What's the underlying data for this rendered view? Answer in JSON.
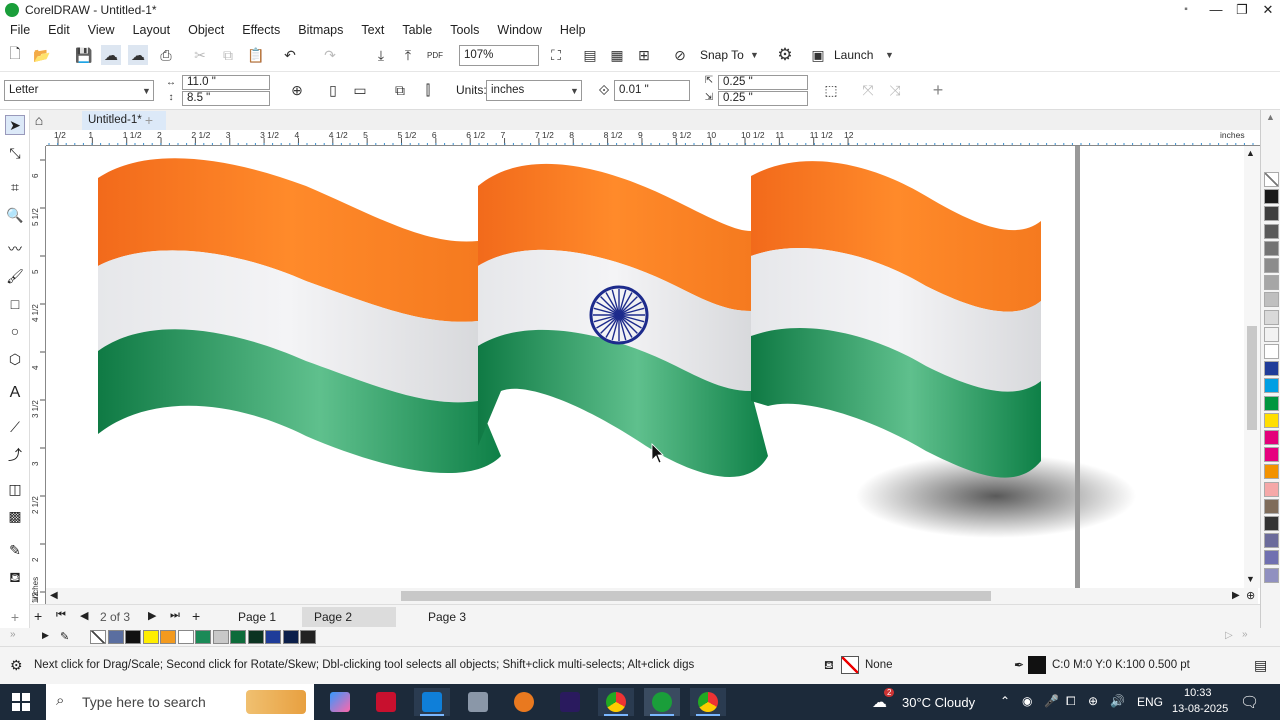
{
  "title": "CorelDRAW - Untitled-1*",
  "menu": [
    "File",
    "Edit",
    "View",
    "Layout",
    "Object",
    "Effects",
    "Bitmaps",
    "Text",
    "Table",
    "Tools",
    "Window",
    "Help"
  ],
  "toolbar": {
    "zoom_value": "107%",
    "snap_label": "Snap To",
    "launch_label": "Launch"
  },
  "property_bar": {
    "page_size": "Letter",
    "width": "11.0 \"",
    "height": "8.5 \"",
    "units_label": "Units:",
    "units_value": "inches",
    "nudge": "0.01 \"",
    "dup_x": "0.25 \"",
    "dup_y": "0.25 \""
  },
  "doc_tab": "Untitled-1*",
  "ruler": {
    "h_labels": [
      "1/2",
      "1",
      "1 1/2",
      "2",
      "2 1/2",
      "3",
      "3 1/2",
      "4",
      "4 1/2",
      "5",
      "5 1/2",
      "6",
      "6 1/2",
      "7",
      "7 1/2",
      "8",
      "8 1/2",
      "9",
      "9 1/2",
      "10",
      "10 1/2",
      "11",
      "11 1/2",
      "12"
    ],
    "h_unit": "inches",
    "v_labels": [
      "6",
      "5 1/2",
      "5",
      "4 1/2",
      "4",
      "3 1/2",
      "3",
      "2 1/2",
      "2",
      "1 1/2"
    ],
    "v_unit": "inches"
  },
  "pages": {
    "counter": "2 of 3",
    "tabs": [
      "Page 1",
      "Page 2",
      "Page 3"
    ],
    "active": "Page 2"
  },
  "status": {
    "hint": "Next click for Drag/Scale; Second click for Rotate/Skew; Dbl-clicking tool selects all objects; Shift+click multi-selects; Alt+click digs",
    "fill": "None",
    "outline": "C:0 M:0 Y:0 K:100  0.500 pt"
  },
  "palette_colors": [
    "#ffffff",
    "#1a1a1a",
    "#404040",
    "#595959",
    "#737373",
    "#8c8c8c",
    "#a6a6a6",
    "#bfbfbf",
    "#d9d9d9",
    "#f2f2f2",
    "#ffffff",
    "#1f3c99",
    "#009fe3",
    "#00963f",
    "#ffde00",
    "#e3007a",
    "#e6007e",
    "#f39200",
    "#f5a8a8",
    "#7f6c5a",
    "#333333",
    "#6b6b9b",
    "#7070b0",
    "#9090c0"
  ],
  "doc_palette": [
    "#ffffff",
    "#5a6ea0",
    "#111111",
    "#ffee00",
    "#f39a1e",
    "#ffffff",
    "#1b8a57",
    "#c8c8c8",
    "#0d6b3a",
    "#0b3322",
    "#1f3c99",
    "#0b1f4a",
    "#222222"
  ],
  "taskbar": {
    "search_placeholder": "Type here to search",
    "weather": "30°C  Cloudy",
    "lang": "ENG",
    "time": "10:33",
    "date": "13-08-2025",
    "badge": "2"
  }
}
